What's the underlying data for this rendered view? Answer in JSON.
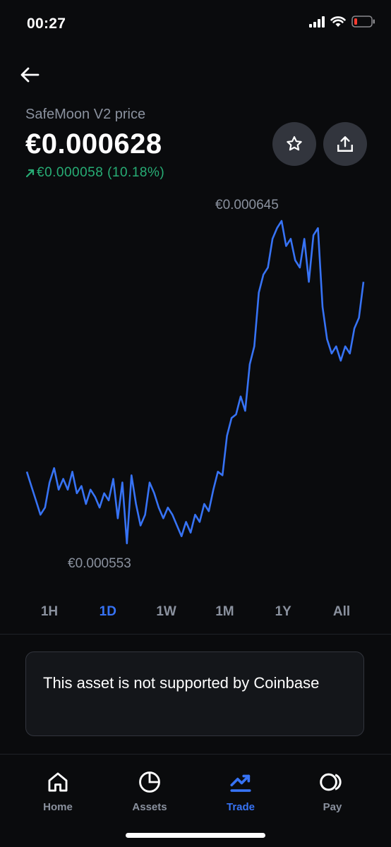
{
  "status_bar": {
    "time": "00:27"
  },
  "asset": {
    "name": "SafeMoon V2 price",
    "price": "€0.000628",
    "change": "€0.000058 (10.18%)",
    "change_color": "#27ad75"
  },
  "chart": {
    "high_label": "€0.000645",
    "low_label": "€0.000553",
    "line_color": "#3773f5"
  },
  "chart_data": {
    "type": "line",
    "series": [
      {
        "values": [
          0.000575,
          0.000571,
          0.000567,
          0.000563,
          0.000565,
          0.000572,
          0.000576,
          0.00057,
          0.000573,
          0.00057,
          0.000575,
          0.000569,
          0.000571,
          0.000566,
          0.00057,
          0.000568,
          0.000565,
          0.000569,
          0.000567,
          0.000573,
          0.000562,
          0.000572,
          0.000555,
          0.000574,
          0.000566,
          0.00056,
          0.000563,
          0.000572,
          0.000569,
          0.000565,
          0.000562,
          0.000565,
          0.000563,
          0.00056,
          0.000557,
          0.000561,
          0.000558,
          0.000563,
          0.000561,
          0.000566,
          0.000564,
          0.00057,
          0.000575,
          0.000574,
          0.000585,
          0.00059,
          0.000591,
          0.000596,
          0.000592,
          0.000605,
          0.00061,
          0.000625,
          0.00063,
          0.000632,
          0.00064,
          0.000643,
          0.000645,
          0.000638,
          0.00064,
          0.000634,
          0.000632,
          0.00064,
          0.000628,
          0.000641,
          0.000643,
          0.000621,
          0.000612,
          0.000608,
          0.00061,
          0.000606,
          0.00061,
          0.000608,
          0.000615,
          0.000618,
          0.000628
        ]
      }
    ],
    "high": 0.000645,
    "low": 0.000553,
    "xlabel": "",
    "ylabel": ""
  },
  "ranges": [
    "1H",
    "1D",
    "1W",
    "1M",
    "1Y",
    "All"
  ],
  "active_range": "1D",
  "notice": {
    "text": "This asset is not supported by Coinbase"
  },
  "tabs": [
    {
      "label": "Home",
      "icon": "home-icon"
    },
    {
      "label": "Assets",
      "icon": "pie-chart-icon"
    },
    {
      "label": "Trade",
      "icon": "trend-icon"
    },
    {
      "label": "Pay",
      "icon": "pay-icon"
    }
  ],
  "active_tab": "Trade"
}
